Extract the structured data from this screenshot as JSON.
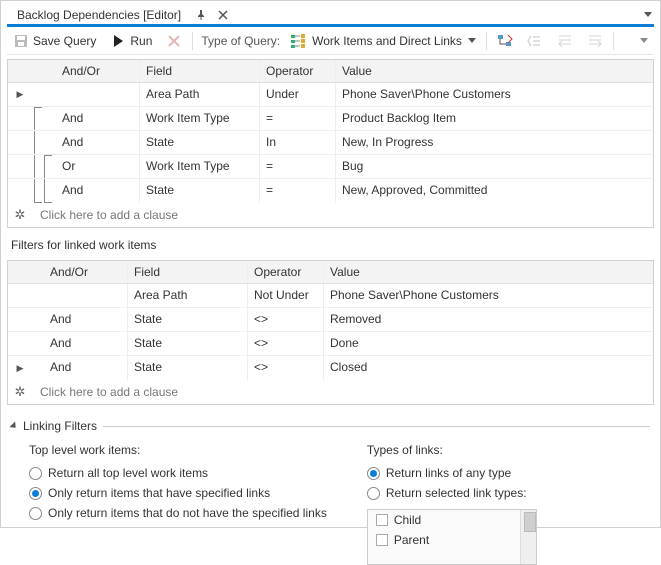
{
  "tab": {
    "title": "Backlog Dependencies [Editor]"
  },
  "toolbar": {
    "save": "Save Query",
    "run": "Run",
    "qtype_label": "Type of Query:",
    "qtype_value": "Work Items and Direct Links"
  },
  "grid1": {
    "headers": {
      "ao": "And/Or",
      "field": "Field",
      "op": "Operator",
      "val": "Value"
    },
    "rows": [
      {
        "marker": "▶",
        "indent": 0,
        "ao": "",
        "field": "Area Path",
        "op": "Under",
        "val": "Phone Saver\\Phone Customers"
      },
      {
        "marker": "",
        "indent": 1,
        "ao": "And",
        "field": "Work Item Type",
        "op": "=",
        "val": "Product Backlog Item"
      },
      {
        "marker": "",
        "indent": 1,
        "ao": "And",
        "field": "State",
        "op": "In",
        "val": "New, In Progress"
      },
      {
        "marker": "",
        "indent": 2,
        "ao": "Or",
        "field": "Work Item Type",
        "op": "=",
        "val": "Bug"
      },
      {
        "marker": "",
        "indent": 2,
        "ao": "And",
        "field": "State",
        "op": "=",
        "val": "New, Approved, Committed"
      }
    ],
    "add": "Click here to add a clause"
  },
  "linked_title": "Filters for linked work items",
  "grid2": {
    "headers": {
      "ao": "And/Or",
      "field": "Field",
      "op": "Operator",
      "val": "Value"
    },
    "rows": [
      {
        "marker": "",
        "ao": "",
        "field": "Area Path",
        "op": "Not Under",
        "val": "Phone Saver\\Phone Customers"
      },
      {
        "marker": "",
        "ao": "And",
        "field": "State",
        "op": "<>",
        "val": "Removed"
      },
      {
        "marker": "",
        "ao": "And",
        "field": "State",
        "op": "<>",
        "val": "Done"
      },
      {
        "marker": "▶",
        "ao": "And",
        "field": "State",
        "op": "<>",
        "val": "Closed"
      }
    ],
    "add": "Click here to add a clause"
  },
  "linking": {
    "title": "Linking Filters",
    "left_label": "Top level work items:",
    "left": [
      {
        "label": "Return all top level work items",
        "sel": false
      },
      {
        "label": "Only return items that have specified links",
        "sel": true
      },
      {
        "label": "Only return items that do not have the specified links",
        "sel": false
      }
    ],
    "right_label": "Types of links:",
    "right": [
      {
        "label": "Return links of any type",
        "sel": true
      },
      {
        "label": "Return selected link types:",
        "sel": false
      }
    ],
    "types": [
      "Child",
      "Parent"
    ]
  }
}
